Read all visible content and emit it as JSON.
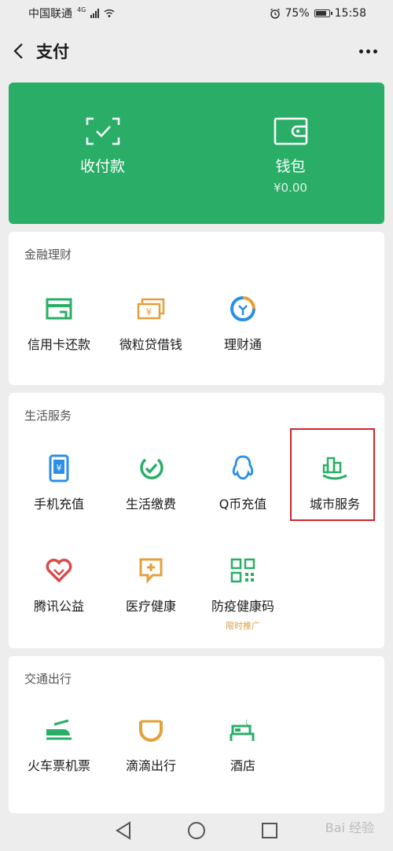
{
  "status_bar": {
    "carrier": "中国联通",
    "network": "4G",
    "battery": "75%",
    "time": "15:58"
  },
  "nav": {
    "title": "支付"
  },
  "wallet": {
    "pay_label": "收付款",
    "wallet_label": "钱包",
    "balance": "¥0.00"
  },
  "finance": {
    "title": "金融理财",
    "items": [
      {
        "label": "信用卡还款",
        "icon": "credit-card-icon"
      },
      {
        "label": "微粒贷借钱",
        "icon": "loan-icon"
      },
      {
        "label": "理财通",
        "icon": "wealth-icon"
      }
    ]
  },
  "life": {
    "title": "生活服务",
    "items": [
      {
        "label": "手机充值",
        "icon": "phone-recharge-icon"
      },
      {
        "label": "生活缴费",
        "icon": "utility-payment-icon"
      },
      {
        "label": "Q币充值",
        "icon": "qq-coin-icon"
      },
      {
        "label": "城市服务",
        "icon": "city-service-icon"
      },
      {
        "label": "腾讯公益",
        "icon": "charity-icon"
      },
      {
        "label": "医疗健康",
        "icon": "medical-icon"
      },
      {
        "label": "防疫健康码",
        "icon": "qr-code-icon",
        "badge": "限时推广"
      }
    ]
  },
  "transport": {
    "title": "交通出行",
    "items": [
      {
        "label": "火车票机票",
        "icon": "train-plane-icon"
      },
      {
        "label": "滴滴出行",
        "icon": "didi-icon"
      },
      {
        "label": "酒店",
        "icon": "hotel-icon"
      }
    ]
  },
  "watermark": "Bai 经验",
  "colors": {
    "wallet_green": "#2aae67",
    "icon_green": "#2aae67",
    "icon_orange": "#e3a03b",
    "icon_blue": "#2b8ee8",
    "icon_red": "#d94a4a",
    "highlight_red": "#d0242a"
  }
}
